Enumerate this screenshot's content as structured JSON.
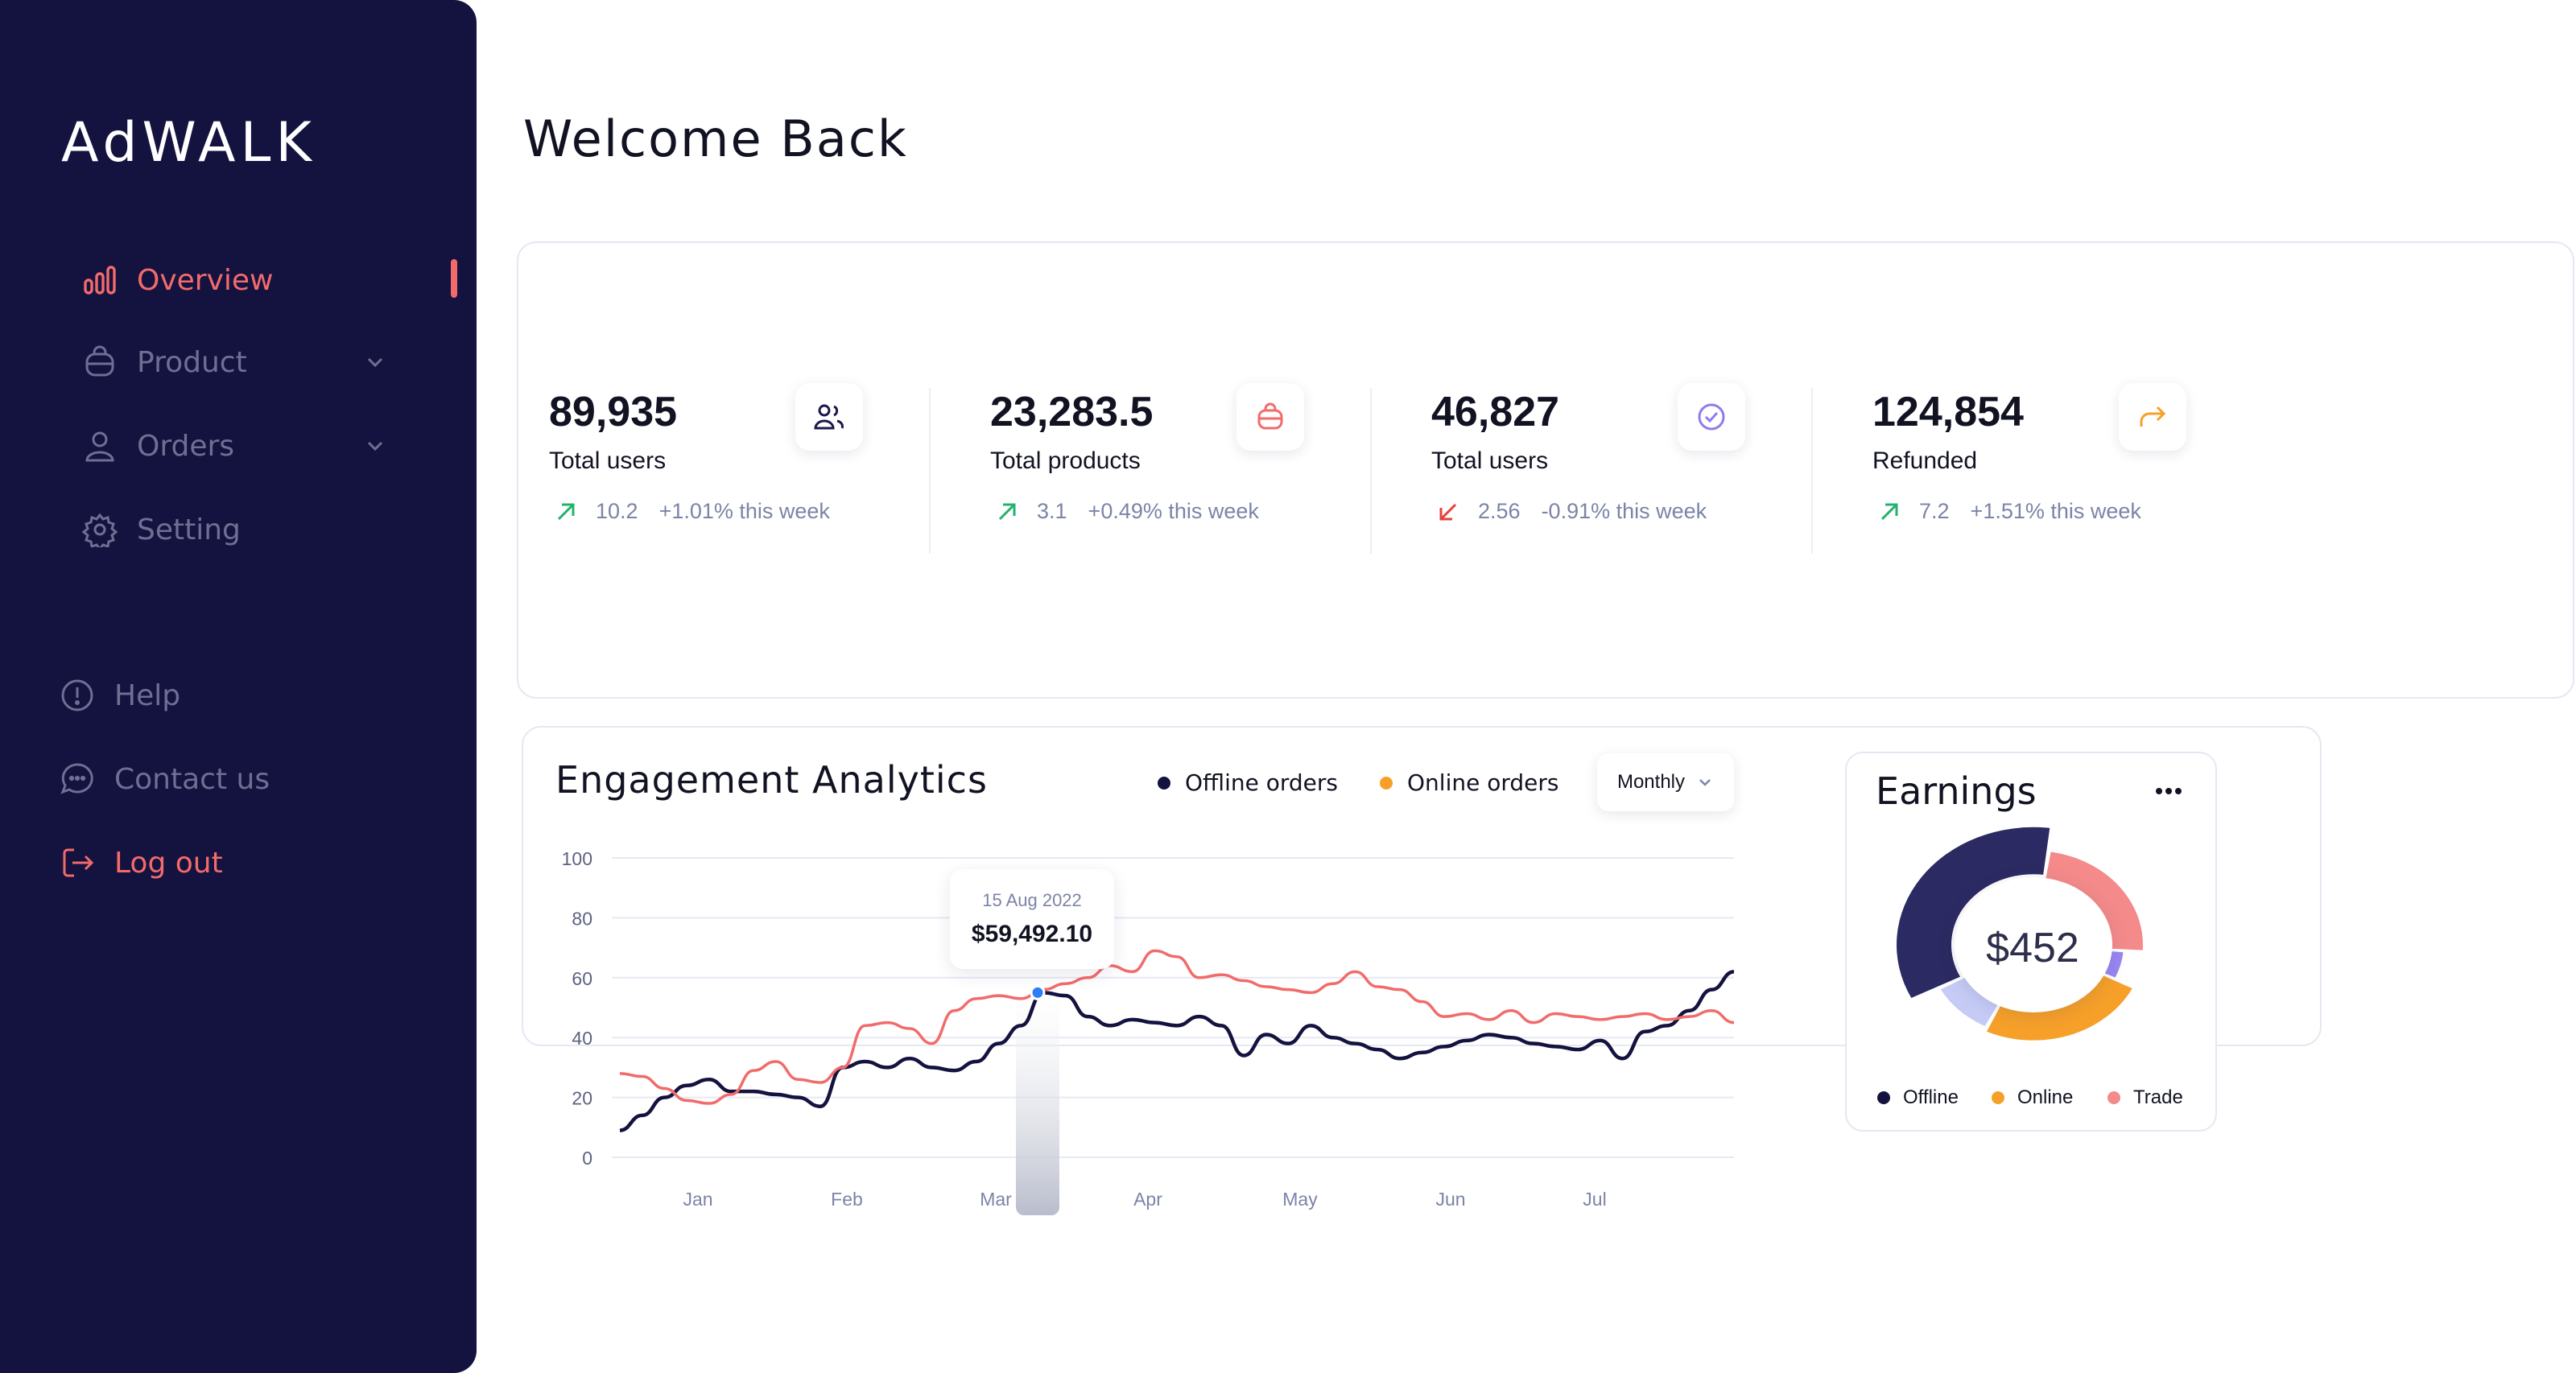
{
  "brand": {
    "logo": "AdWALK"
  },
  "sidebar": {
    "nav": [
      {
        "label": "Overview",
        "icon": "bar-chart-icon",
        "active": true
      },
      {
        "label": "Product",
        "icon": "bag-icon",
        "expandable": true
      },
      {
        "label": "Orders",
        "icon": "user-icon",
        "expandable": true
      },
      {
        "label": "Setting",
        "icon": "gear-icon"
      }
    ],
    "secondary": [
      {
        "label": "Help",
        "icon": "alert-circle-icon"
      },
      {
        "label": "Contact us",
        "icon": "chat-bubble-icon"
      },
      {
        "label": "Log out",
        "icon": "logout-icon"
      }
    ]
  },
  "header": {
    "title": "Welcome Back"
  },
  "stats": [
    {
      "value": "89,935",
      "label": "Total users",
      "trend_dir": "up",
      "trend_value": "10.2",
      "trend_text": "+1.01% this week",
      "icon": "users-icon",
      "icon_color": "#1b1a4a"
    },
    {
      "value": "23,283.5",
      "label": "Total products",
      "trend_dir": "up",
      "trend_value": "3.1",
      "trend_text": "+0.49% this week",
      "icon": "bag-icon",
      "icon_color": "#f26b6b"
    },
    {
      "value": "46,827",
      "label": "Total users",
      "trend_dir": "down",
      "trend_value": "2.56",
      "trend_text": "-0.91% this week",
      "icon": "check-circle-icon",
      "icon_color": "#8d7cf0"
    },
    {
      "value": "124,854",
      "label": "Refunded",
      "trend_dir": "up",
      "trend_value": "7.2",
      "trend_text": "+1.51% this week",
      "icon": "share-arrow-icon",
      "icon_color": "#f6a02a"
    }
  ],
  "engagement": {
    "title": "Engagement Analytics",
    "legend": [
      {
        "label": "Offline orders",
        "color": "#14123f"
      },
      {
        "label": "Online orders",
        "color": "#f6a02a"
      }
    ],
    "period": "Monthly",
    "tooltip": {
      "date": "15 Aug 2022",
      "value": "$59,492.10"
    }
  },
  "chart_data": {
    "type": "line",
    "y_ticks": [
      "0",
      "20",
      "40",
      "60",
      "80",
      "100"
    ],
    "ylim": [
      0,
      100
    ],
    "x_ticks": [
      "Jan",
      "Feb",
      "Mar",
      "Apr",
      "May",
      "Jun",
      "Jul"
    ],
    "grid": true,
    "series": [
      {
        "name": "Offline orders",
        "color": "#14123f",
        "values": [
          9,
          14,
          20,
          24,
          26,
          22,
          22,
          21,
          20,
          17,
          30,
          32,
          30,
          33,
          30,
          29,
          32,
          38,
          44,
          55,
          54,
          47,
          44,
          46,
          45,
          44,
          47,
          44,
          34,
          41,
          38,
          44,
          40,
          38,
          36,
          33,
          35,
          37,
          39,
          41,
          40,
          38,
          37,
          36,
          39,
          33,
          42,
          44,
          49,
          56,
          62
        ]
      },
      {
        "name": "Online orders",
        "color": "#f26b6b",
        "values": [
          28,
          27,
          23,
          19,
          18,
          21,
          29,
          32,
          26,
          25,
          30,
          44,
          45,
          43,
          38,
          49,
          53,
          54,
          53,
          56,
          58,
          60,
          64,
          62,
          69,
          67,
          60,
          61,
          59,
          57,
          56,
          55,
          58,
          62,
          57,
          56,
          52,
          47,
          48,
          46,
          49,
          45,
          48,
          47,
          46,
          47,
          48,
          46,
          47,
          49,
          45
        ]
      }
    ],
    "tooltip_point": {
      "x_label": "15 Aug 2022",
      "value": "$59,492.10"
    }
  },
  "earnings": {
    "title": "Earnings",
    "center_value": "$452",
    "segments": [
      {
        "name": "Offline",
        "value": 35,
        "color": "#2b2a62"
      },
      {
        "name": "Offline-light",
        "value": 10,
        "color": "#c6cbf6"
      },
      {
        "name": "Online",
        "value": 25,
        "color": "#f6a02a"
      },
      {
        "name": "Purple",
        "value": 6,
        "color": "#9a86f2"
      },
      {
        "name": "Trade",
        "value": 24,
        "color": "#f48a8a"
      }
    ],
    "legend": [
      {
        "label": "Offline",
        "color": "#14123f"
      },
      {
        "label": "Online",
        "color": "#f6a02a"
      },
      {
        "label": "Trade",
        "color": "#f48a8a"
      }
    ]
  }
}
